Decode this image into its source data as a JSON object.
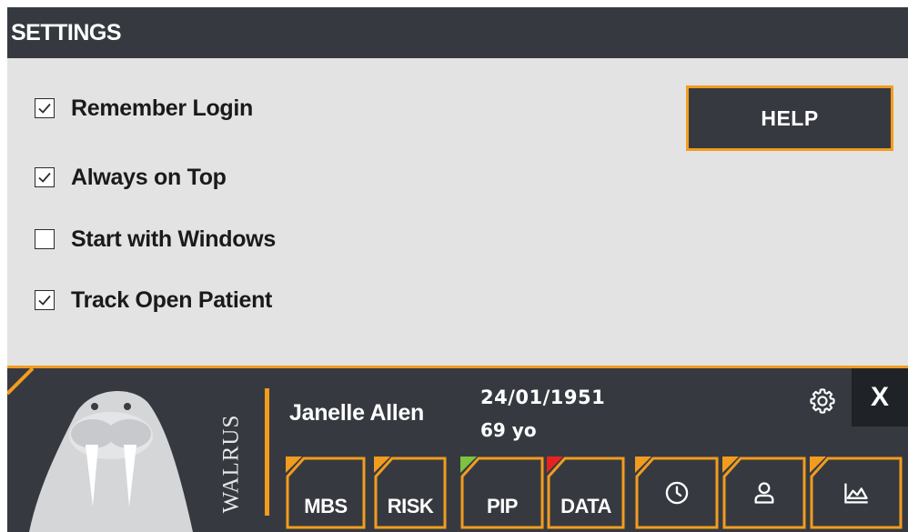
{
  "settings": {
    "title": "SETTINGS",
    "options": [
      {
        "label": "Remember Login",
        "checked": true
      },
      {
        "label": "Always on Top",
        "checked": true
      },
      {
        "label": "Start with Windows",
        "checked": false
      },
      {
        "label": "Track Open Patient",
        "checked": true
      }
    ],
    "help_label": "HELP"
  },
  "patient_bar": {
    "brand": "WALRUS",
    "patient_name": "Janelle Allen",
    "dob": "24/01/1951",
    "age": "69 yo",
    "close_label": "X",
    "tabs": [
      {
        "label": "MBS",
        "accent": "#f29c1f"
      },
      {
        "label": "RISK",
        "accent": "#f29c1f"
      },
      {
        "label": "PIP",
        "accent": "#7dc242"
      },
      {
        "label": "DATA",
        "accent": "#e8231f"
      },
      {
        "icon": "clock-icon",
        "accent": "#f29c1f"
      },
      {
        "icon": "person-icon",
        "accent": "#f29c1f"
      },
      {
        "icon": "chart-icon",
        "accent": "#f29c1f"
      }
    ]
  },
  "colors": {
    "panel_dark": "#363a40",
    "accent_orange": "#f29c1f",
    "settings_bg": "#e3e3e3"
  }
}
